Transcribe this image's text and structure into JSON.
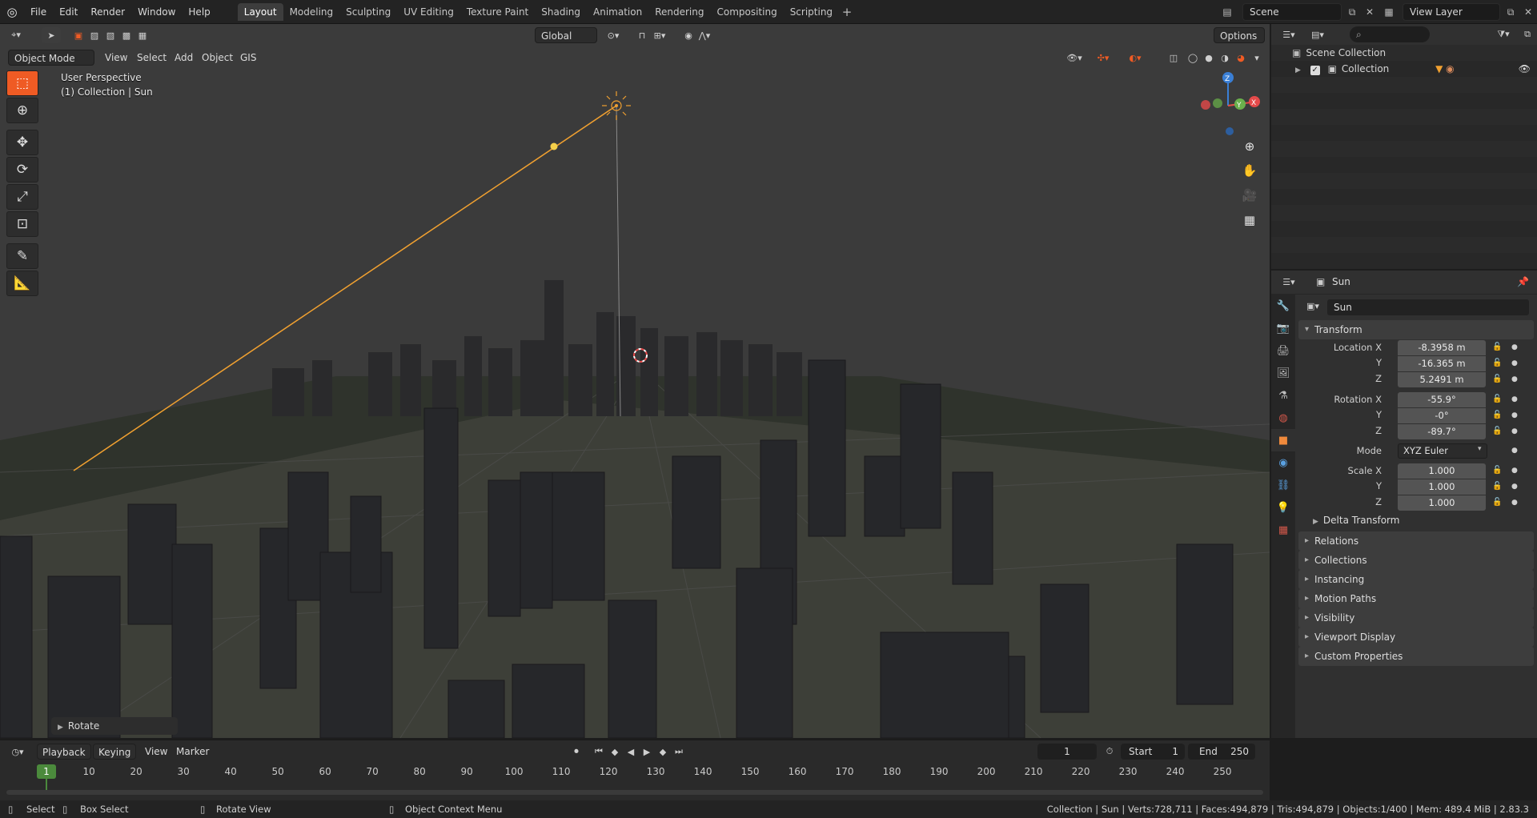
{
  "topbar": {
    "menus": [
      "File",
      "Edit",
      "Render",
      "Window",
      "Help"
    ],
    "workspaces": [
      "Layout",
      "Modeling",
      "Sculpting",
      "UV Editing",
      "Texture Paint",
      "Shading",
      "Animation",
      "Rendering",
      "Compositing",
      "Scripting"
    ],
    "active_workspace": "Layout",
    "add_tab": "+",
    "scene": "Scene",
    "view_layer": "View Layer"
  },
  "viewport": {
    "mode": "Object Mode",
    "menus": [
      "View",
      "Select",
      "Add",
      "Object",
      "GIS"
    ],
    "orientation": "Global",
    "options": "Options",
    "perspective_label": "User Perspective",
    "collection_label": "(1) Collection | Sun",
    "rotate_panel": "Rotate",
    "gizmo": {
      "x": "X",
      "y": "Y",
      "z": "Z"
    }
  },
  "outliner": {
    "scene_collection": "Scene Collection",
    "collection": "Collection"
  },
  "properties": {
    "header_object": "Sun",
    "object_name": "Sun",
    "transform_title": "Transform",
    "location": {
      "label_x": "Location X",
      "label_y": "Y",
      "label_z": "Z",
      "x": "-8.3958 m",
      "y": "-16.365 m",
      "z": "5.2491 m"
    },
    "rotation": {
      "label_x": "Rotation X",
      "label_y": "Y",
      "label_z": "Z",
      "x": "-55.9°",
      "y": "-0°",
      "z": "-89.7°"
    },
    "mode_label": "Mode",
    "mode_value": "XYZ Euler",
    "scale": {
      "label_x": "Scale X",
      "label_y": "Y",
      "label_z": "Z",
      "x": "1.000",
      "y": "1.000",
      "z": "1.000"
    },
    "delta_transform": "Delta Transform",
    "panels": [
      "Relations",
      "Collections",
      "Instancing",
      "Motion Paths",
      "Visibility",
      "Viewport Display",
      "Custom Properties"
    ]
  },
  "timeline": {
    "playback": "Playback",
    "keying": "Keying",
    "view": "View",
    "marker": "Marker",
    "current_frame": "1",
    "start_label": "Start",
    "start": "1",
    "end_label": "End",
    "end": "250",
    "ticks": [
      "10",
      "20",
      "30",
      "40",
      "50",
      "60",
      "70",
      "80",
      "90",
      "100",
      "110",
      "120",
      "130",
      "140",
      "150",
      "160",
      "170",
      "180",
      "190",
      "200",
      "210",
      "220",
      "230",
      "240",
      "250"
    ],
    "playhead": "1"
  },
  "statusbar": {
    "select": "Select",
    "box_select": "Box Select",
    "rotate_view": "Rotate View",
    "context_menu": "Object Context Menu",
    "stats": "Collection | Sun | Verts:728,711 | Faces:494,879 | Tris:494,879 | Objects:1/400 | Mem: 489.4 MiB | 2.83.3"
  },
  "colors": {
    "accent": "#ef5b24",
    "sun_line": "#f0a030",
    "frame_marker": "#4b8a3c",
    "gizmo_x": "#e44a4a",
    "gizmo_y": "#6ab04c",
    "gizmo_z": "#3a7fd5"
  }
}
